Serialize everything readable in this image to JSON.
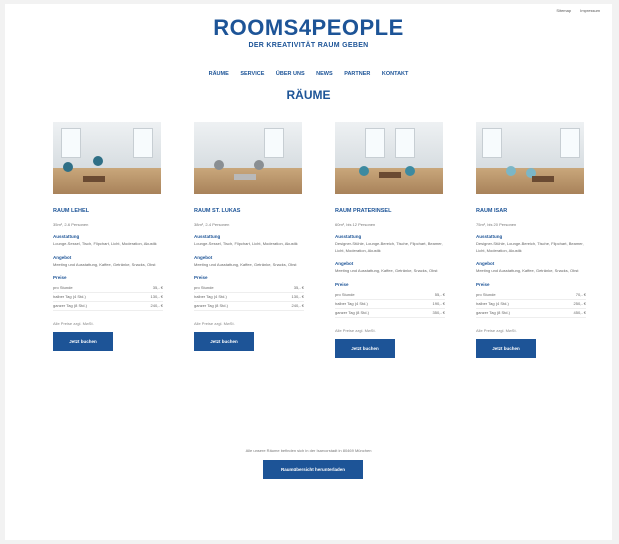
{
  "top_links": [
    "Sitemap",
    "Impressum"
  ],
  "logo": {
    "text": "ROOMS4PEOPLE",
    "tagline": "DER KREATIVITÄT RAUM GEBEN"
  },
  "nav": [
    "RÄUME",
    "SERVICE",
    "ÜBER UNS",
    "NEWS",
    "PARTNER",
    "KONTAKT"
  ],
  "page_title": "RÄUME",
  "rooms": [
    {
      "name": "RAUM LEHEL",
      "meta": "35m², 2-6 Personen",
      "ausstattung_label": "Ausstattung",
      "ausstattung": "Lounge-Sessel, Tisch, Flipchart, Licht, Moderation, Akustik",
      "angebot_label": "Angebot",
      "angebot": "Meeting und Ausstattung, Kaffee, Getränke, Snacks, Obst",
      "preise_label": "Preise",
      "prices": [
        {
          "label": "pro Stunde",
          "value": "35,- €"
        },
        {
          "label": "halber Tag (4 Std.)",
          "value": "130,- €"
        },
        {
          "label": "ganzer Tag (8 Std.)",
          "value": "240,- €"
        }
      ],
      "net": "Alle Preise zzgl. MwSt.",
      "button": "Jetzt buchen"
    },
    {
      "name": "RAUM ST. LUKAS",
      "meta": "38m², 2-4 Personen",
      "ausstattung_label": "Ausstattung",
      "ausstattung": "Lounge-Sessel, Tisch, Flipchart, Licht, Moderation, Akustik",
      "angebot_label": "Angebot",
      "angebot": "Meeting und Ausstattung, Kaffee, Getränke, Snacks, Obst",
      "preise_label": "Preise",
      "prices": [
        {
          "label": "pro Stunde",
          "value": "35,- €"
        },
        {
          "label": "halber Tag (4 Std.)",
          "value": "130,- €"
        },
        {
          "label": "ganzer Tag (8 Std.)",
          "value": "240,- €"
        }
      ],
      "net": "Alle Preise zzgl. MwSt.",
      "button": "Jetzt buchen"
    },
    {
      "name": "RAUM PRATERINSEL",
      "meta": "60m², bis 12 Personen",
      "ausstattung_label": "Ausstattung",
      "ausstattung": "Designer-Stühle, Lounge-Bereich, Tische, Flipchart, Beamer, Licht, Moderation, Akustik",
      "angebot_label": "Angebot",
      "angebot": "Meeting und Ausstattung, Kaffee, Getränke, Snacks, Obst",
      "preise_label": "Preise",
      "prices": [
        {
          "label": "pro Stunde",
          "value": "55,- €"
        },
        {
          "label": "halber Tag (4 Std.)",
          "value": "190,- €"
        },
        {
          "label": "ganzer Tag (8 Std.)",
          "value": "350,- €"
        }
      ],
      "net": "Alle Preise zzgl. MwSt.",
      "button": "Jetzt buchen"
    },
    {
      "name": "RAUM ISAR",
      "meta": "75m², bis 20 Personen",
      "ausstattung_label": "Ausstattung",
      "ausstattung": "Designer-Stühle, Lounge-Bereich, Tische, Flipchart, Beamer, Licht, Moderation, Akustik",
      "angebot_label": "Angebot",
      "angebot": "Meeting und Ausstattung, Kaffee, Getränke, Snacks, Obst",
      "preise_label": "Preise",
      "prices": [
        {
          "label": "pro Stunde",
          "value": "70,- €"
        },
        {
          "label": "halber Tag (4 Std.)",
          "value": "250,- €"
        },
        {
          "label": "ganzer Tag (8 Std.)",
          "value": "450,- €"
        }
      ],
      "net": "Alle Preise zzgl. MwSt.",
      "button": "Jetzt buchen"
    }
  ],
  "footer": {
    "note": "Alle unsere Räume befinden sich in der Isarvorstadt in 80469 München",
    "button": "Raumübersicht herunterladen"
  },
  "colors": {
    "brand": "#1d5497"
  }
}
